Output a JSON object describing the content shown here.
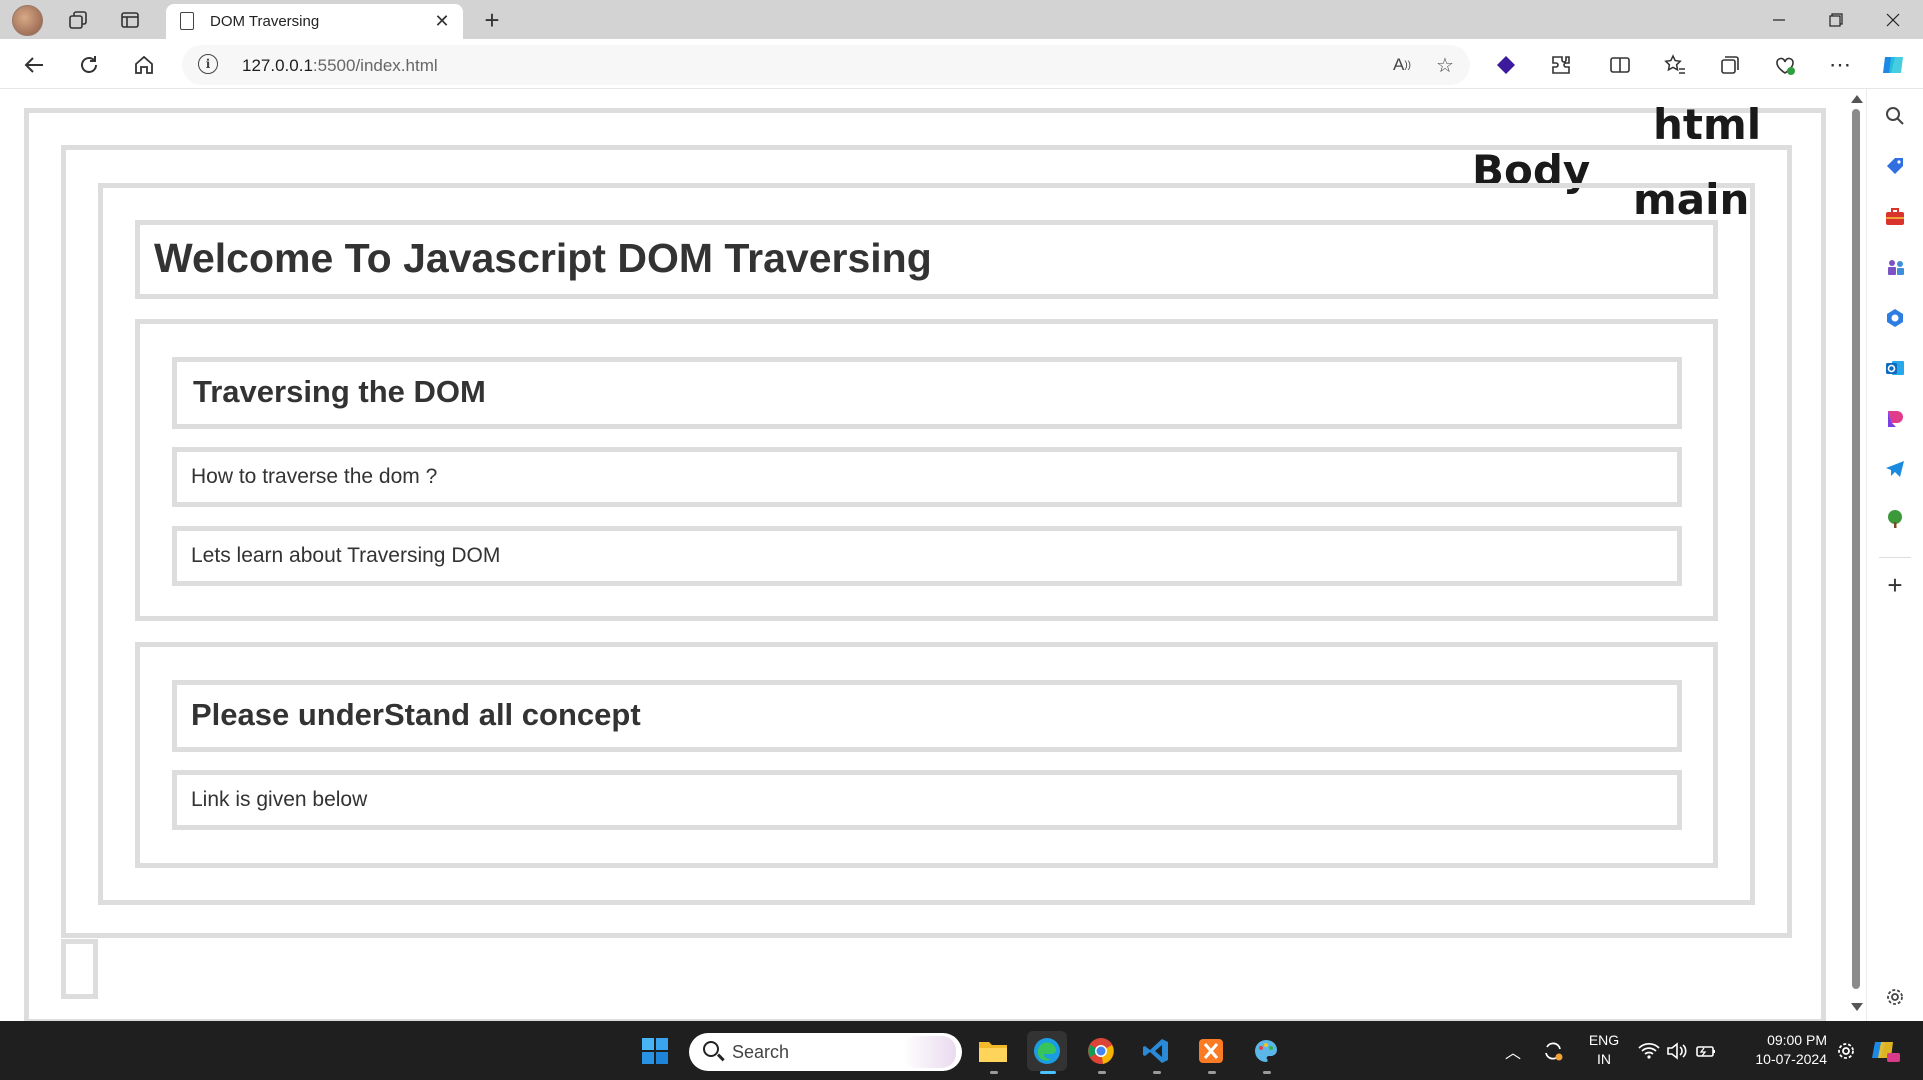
{
  "browser": {
    "tab": {
      "title": "DOM Traversing"
    },
    "address": {
      "host": "127.0.0.1",
      "path": ":5500/index.html"
    },
    "read_aloud_label": "A"
  },
  "page": {
    "labels": {
      "html": "html",
      "body": "Body",
      "main": "main"
    },
    "header": {
      "title": "Welcome To Javascript DOM Traversing"
    },
    "section1": {
      "heading": "Traversing the DOM",
      "paragraphs": [
        "How to traverse the dom ?",
        "Lets learn about Traversing DOM"
      ]
    },
    "section2": {
      "heading": "Please underStand all concept",
      "paragraph": "Link is given below"
    }
  },
  "taskbar": {
    "search_placeholder": "Search",
    "language": "ENG",
    "region": "IN",
    "time": "09:00 PM",
    "date": "10-07-2024"
  },
  "colors": {
    "tabstrip": "#d3d3d3",
    "box_border": "#dddddd",
    "taskbar": "#1f1f1f",
    "accent": "#4cc2ff"
  }
}
